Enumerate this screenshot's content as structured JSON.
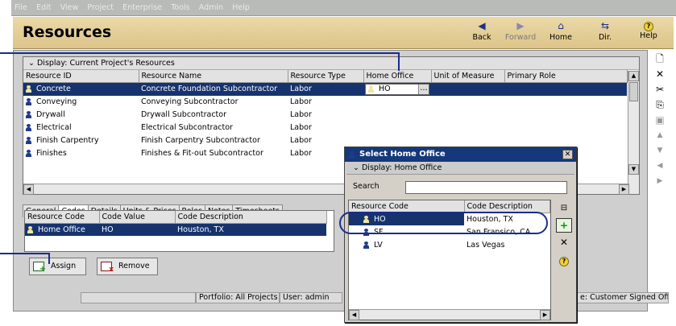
{
  "menu": [
    "File",
    "Edit",
    "View",
    "Project",
    "Enterprise",
    "Tools",
    "Admin",
    "Help"
  ],
  "header": {
    "title": "Resources",
    "nav": [
      {
        "label": "Back",
        "icon": "back-arrow-icon",
        "glyph": "◀"
      },
      {
        "label": "Forward",
        "icon": "forward-arrow-icon",
        "glyph": "▶"
      },
      {
        "label": "Home",
        "icon": "home-icon",
        "glyph": "⌂"
      },
      {
        "label": "Dir.",
        "icon": "directory-icon",
        "glyph": "⇆"
      },
      {
        "label": "Help",
        "icon": "help-icon",
        "glyph": "?"
      }
    ]
  },
  "resources_grid": {
    "display": "Display: Current Project's Resources",
    "columns": [
      "Resource ID",
      "Resource Name",
      "Resource Type",
      "Home Office",
      "Unit of Measure",
      "Primary Role"
    ],
    "rows": [
      {
        "id": "Concrete",
        "name": "Concrete Foundation Subcontractor",
        "type": "Labor",
        "home_office": "HO",
        "selected": true
      },
      {
        "id": "Conveying",
        "name": "Conveying Subcontractor",
        "type": "Labor",
        "home_office": "",
        "selected": false
      },
      {
        "id": "Drywall",
        "name": "Drywall Subcontractor",
        "type": "Labor",
        "home_office": "",
        "selected": false
      },
      {
        "id": "Electrical",
        "name": "Electrical Subcontractor",
        "type": "Labor",
        "home_office": "",
        "selected": false
      },
      {
        "id": "Finish Carpentry",
        "name": "Finish Carpentry Subcontractor",
        "type": "Labor",
        "home_office": "",
        "selected": false
      },
      {
        "id": "Finishes",
        "name": "Finishes & Fit-out Subcontractor",
        "type": "Labor",
        "home_office": "",
        "selected": false
      }
    ]
  },
  "tabs": [
    "General",
    "Codes",
    "Details",
    "Units & Prices",
    "Roles",
    "Notes",
    "Timesheets"
  ],
  "active_tab": "Codes",
  "codes_grid": {
    "columns": [
      "Resource Code",
      "Code Value",
      "Code Description"
    ],
    "rows": [
      {
        "code": "Home Office",
        "value": "HO",
        "description": "Houston, TX"
      }
    ]
  },
  "buttons": {
    "assign": "Assign",
    "remove": "Remove"
  },
  "status": {
    "portfolio": "Portfolio: All Projects",
    "user": "User: admin",
    "signoff": "e: Customer Signed Off"
  },
  "dialog": {
    "title": "Select Home Office",
    "display": "Display: Home Office",
    "search_label": "Search",
    "search_value": "",
    "columns": [
      "Resource Code",
      "Code Description"
    ],
    "rows": [
      {
        "code": "HO",
        "description": "Houston, TX",
        "selected": true
      },
      {
        "code": "SF",
        "description": "San Fransico, CA",
        "selected": false
      },
      {
        "code": "LV",
        "description": "Las Vegas",
        "selected": false
      }
    ]
  },
  "colors": {
    "header_bg": "#ddc489",
    "selection": "#16336e",
    "callout": "#1a2d8c",
    "dialog_title": "#15387a"
  }
}
